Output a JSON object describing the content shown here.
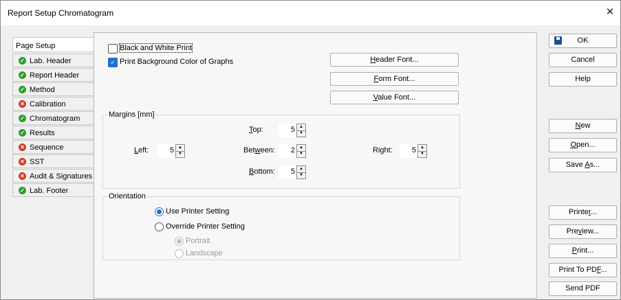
{
  "window": {
    "title": "Report Setup Chromatogram",
    "close_glyph": "✕"
  },
  "tabs": [
    {
      "label": "Page Setup",
      "status": null
    },
    {
      "label": "Lab. Header",
      "status": "ok"
    },
    {
      "label": "Report Header",
      "status": "ok"
    },
    {
      "label": "Method",
      "status": "ok"
    },
    {
      "label": "Calibration",
      "status": "error"
    },
    {
      "label": "Chromatogram",
      "status": "ok"
    },
    {
      "label": "Results",
      "status": "ok"
    },
    {
      "label": "Sequence",
      "status": "error"
    },
    {
      "label": "SST",
      "status": "error"
    },
    {
      "label": "Audit & Signatures",
      "status": "error"
    },
    {
      "label": "Lab. Footer",
      "status": "ok"
    }
  ],
  "options": {
    "bw_print": {
      "label": "Black and White Print",
      "checked": false
    },
    "bg_color": {
      "label": "Print Background Color of Graphs",
      "checked": true
    }
  },
  "font_buttons": {
    "header": {
      "mn": "H",
      "rest": "eader Font..."
    },
    "form": {
      "mn": "F",
      "rest": "orm Font..."
    },
    "value": {
      "mn": "V",
      "rest": "alue Font..."
    }
  },
  "margins": {
    "title": "Margins [mm]",
    "top": {
      "mn": "T",
      "rest": "op:",
      "value": "5"
    },
    "left": {
      "mn": "L",
      "rest": "eft:",
      "value": "5"
    },
    "between": {
      "pre": "Bet",
      "mn": "w",
      "rest": "een:",
      "value": "2"
    },
    "right": {
      "label": "Right:",
      "value": "5"
    },
    "bottom": {
      "mn": "B",
      "rest": "ottom:",
      "value": "5"
    }
  },
  "orientation": {
    "title": "Orientation",
    "use_printer": {
      "label": "Use Printer Setting",
      "selected": true
    },
    "override": {
      "label": "Override Printer Setting",
      "selected": false
    },
    "portrait": {
      "label": "Portrait",
      "selected": true,
      "disabled": true
    },
    "landscape": {
      "label": "Landscape",
      "selected": false,
      "disabled": true
    }
  },
  "side_buttons": {
    "ok": "OK",
    "cancel": "Cancel",
    "help": "Help",
    "new": {
      "mn": "N",
      "rest": "ew"
    },
    "open": {
      "mn": "O",
      "rest": "pen..."
    },
    "save_as": {
      "pre": "Save ",
      "mn": "A",
      "rest": "s..."
    },
    "printer": {
      "pre": "Printe",
      "mn": "r",
      "rest": "..."
    },
    "preview": {
      "pre": "Pre",
      "mn": "v",
      "rest": "iew..."
    },
    "print": {
      "mn": "P",
      "rest": "rint..."
    },
    "print_pdf": {
      "pre": "Print To PD",
      "mn": "F",
      "rest": "..."
    },
    "send_pdf": "Send PDF"
  }
}
